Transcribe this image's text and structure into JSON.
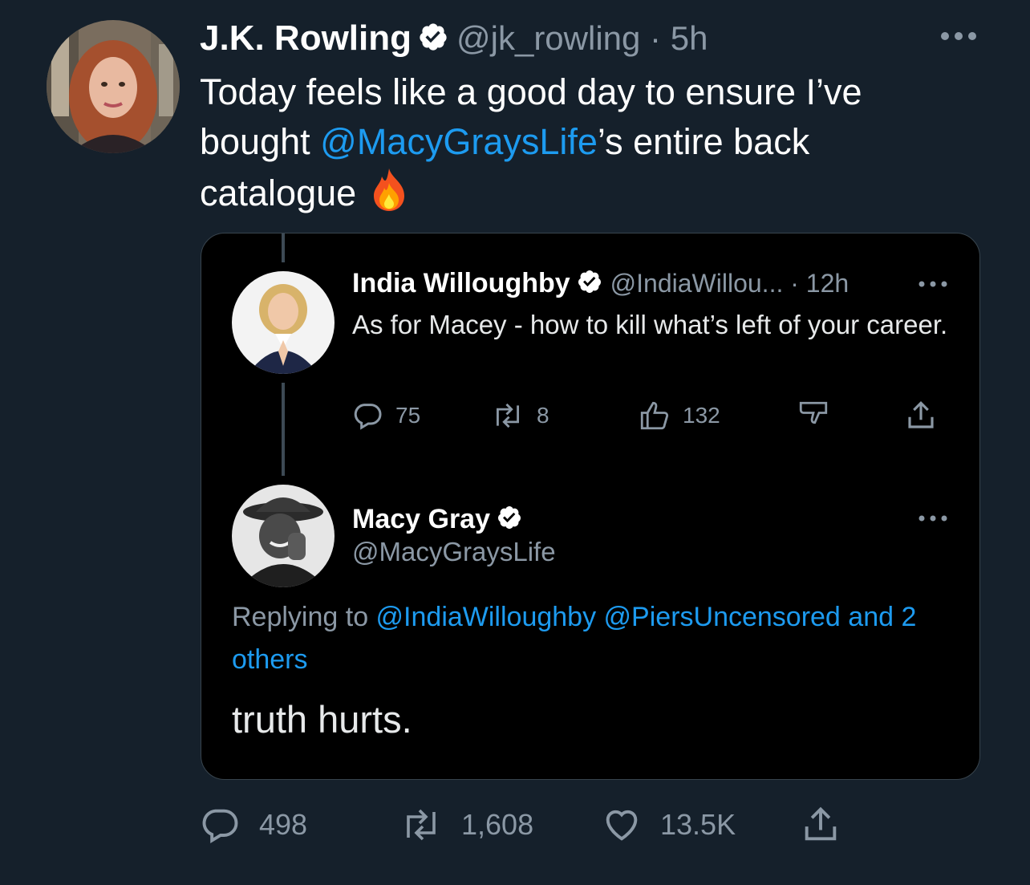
{
  "tweet": {
    "author_name": "J.K. Rowling",
    "author_handle": "@jk_rowling · 5h",
    "text_before": "Today feels like a good day to ensure I’ve bought ",
    "mention": "@MacyGraysLife",
    "text_after": "’s entire back catalogue",
    "emoji": "fire-emoji",
    "stats": {
      "replies": "498",
      "retweets": "1,608",
      "likes": "13.5K"
    }
  },
  "quoted_thread": {
    "parent": {
      "author_name": "India Willoughby",
      "author_handle": "@IndiaWillou... · 12h",
      "text": "As for Macey - how to kill what’s left of your career.",
      "stats": {
        "replies": "75",
        "retweets": "8",
        "upvotes": "132"
      }
    },
    "reply": {
      "author_name": "Macy Gray",
      "author_handle": "@MacyGraysLife",
      "replying_prefix": "Replying to ",
      "replying_mentions": "@IndiaWilloughby @PiersUncensored and 2 others",
      "text": "truth hurts."
    }
  },
  "colors": {
    "background": "#15202b",
    "accent": "#1d9bf0",
    "muted": "#8b98a5",
    "quote_background": "#000000"
  }
}
